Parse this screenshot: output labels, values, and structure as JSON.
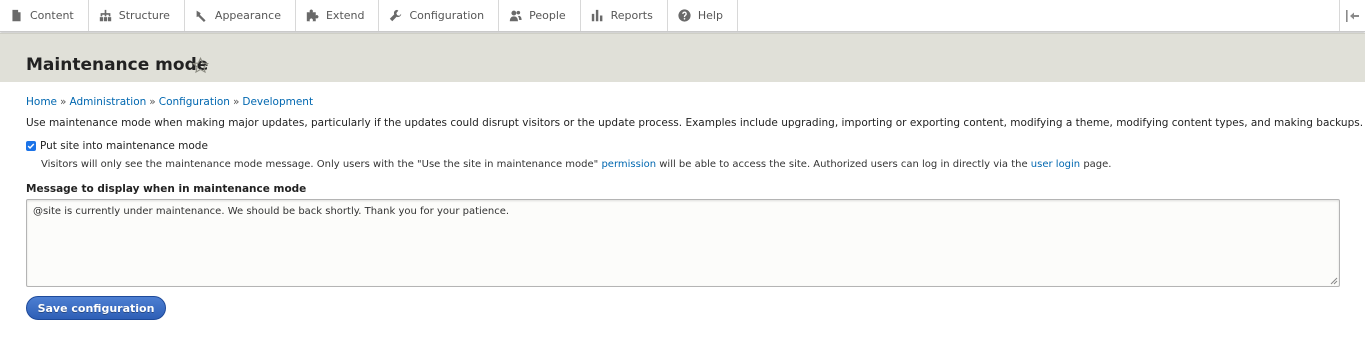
{
  "toolbar": {
    "items": [
      {
        "label": "Content",
        "icon": "document-icon"
      },
      {
        "label": "Structure",
        "icon": "hierarchy-icon"
      },
      {
        "label": "Appearance",
        "icon": "paintbrush-icon"
      },
      {
        "label": "Extend",
        "icon": "puzzle-icon"
      },
      {
        "label": "Configuration",
        "icon": "wrench-icon"
      },
      {
        "label": "People",
        "icon": "people-icon"
      },
      {
        "label": "Reports",
        "icon": "bar-chart-icon"
      },
      {
        "label": "Help",
        "icon": "help-icon"
      }
    ],
    "toggle_icon": "collapse-toolbar-icon"
  },
  "header": {
    "title": "Maintenance mode",
    "shortcut_icon": "star-icon"
  },
  "breadcrumb": {
    "items": [
      "Home",
      "Administration",
      "Configuration",
      "Development"
    ],
    "separator": "»"
  },
  "description": "Use maintenance mode when making major updates, particularly if the updates could disrupt visitors or the update process. Examples include upgrading, importing or exporting content, modifying a theme, modifying content types, and making backups.",
  "maintenance_checkbox": {
    "label": "Put site into maintenance mode",
    "checked": true,
    "help_before": "Visitors will only see the maintenance mode message. Only users with the \"Use the site in maintenance mode\" ",
    "help_link_permission": "permission",
    "help_middle": " will be able to access the site. Authorized users can log in directly via the ",
    "help_link_login": "user login",
    "help_after": " page."
  },
  "message_field": {
    "label": "Message to display when in maintenance mode",
    "value": "@site is currently under maintenance. We should be back shortly. Thank you for your patience."
  },
  "actions": {
    "save_label": "Save configuration"
  },
  "colors": {
    "accent": "#0067b0",
    "button": "#2e5fb6",
    "header_band": "#e0e0d8"
  }
}
